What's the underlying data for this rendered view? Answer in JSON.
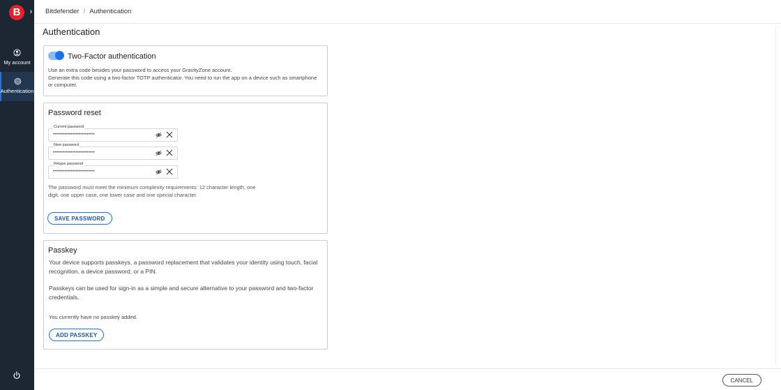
{
  "sidebar": {
    "logo_letter": "B",
    "expand_glyph": "›",
    "items": [
      {
        "label": "My account",
        "icon": "user-circle-icon"
      },
      {
        "label": "Authentication",
        "icon": "fingerprint-icon"
      }
    ],
    "power_icon": "power-icon",
    "colors": {
      "background": "#1d2733",
      "active": "#22364f",
      "logo": "#e4222b"
    }
  },
  "breadcrumb": {
    "root": "Bitdefender",
    "separator": "/",
    "current": "Authentication"
  },
  "page": {
    "title": "Authentication"
  },
  "two_factor": {
    "enabled": true,
    "title": "Two-Factor authentication",
    "desc_line1": "Use an extra code besides your password to access your GravityZone account.",
    "desc_line2": "Generate this code using a two-factor TOTP authenticator. You need to run the app on a device such as smartphone or computer."
  },
  "password_reset": {
    "title": "Password reset",
    "fields": [
      {
        "label": "Current password",
        "value": "••••••••••••••••••••••••••"
      },
      {
        "label": "New password",
        "value": "••••••••••••••••••••••••••"
      },
      {
        "label": "Retype password",
        "value": "••••••••••••••••••••••••••"
      }
    ],
    "hint": "The password must meet the minimum complexity requirements: 12 character length, one digit, one upper case, one lower case and one special character.",
    "save_label": "SAVE PASSWORD"
  },
  "passkey": {
    "title": "Passkey",
    "para1": "Your device supports passkeys, a password replacement that validates your identity using touch, facial recognition, a device password, or a PIN.",
    "para2": "Passkeys can be used for sign-in as a simple and secure alternative to your password and two-factor credentials.",
    "status": "You currently have no passkey added.",
    "add_label": "ADD PASSKEY"
  },
  "footer": {
    "cancel_label": "CANCEL"
  },
  "colors": {
    "accent": "#1a73e8"
  }
}
